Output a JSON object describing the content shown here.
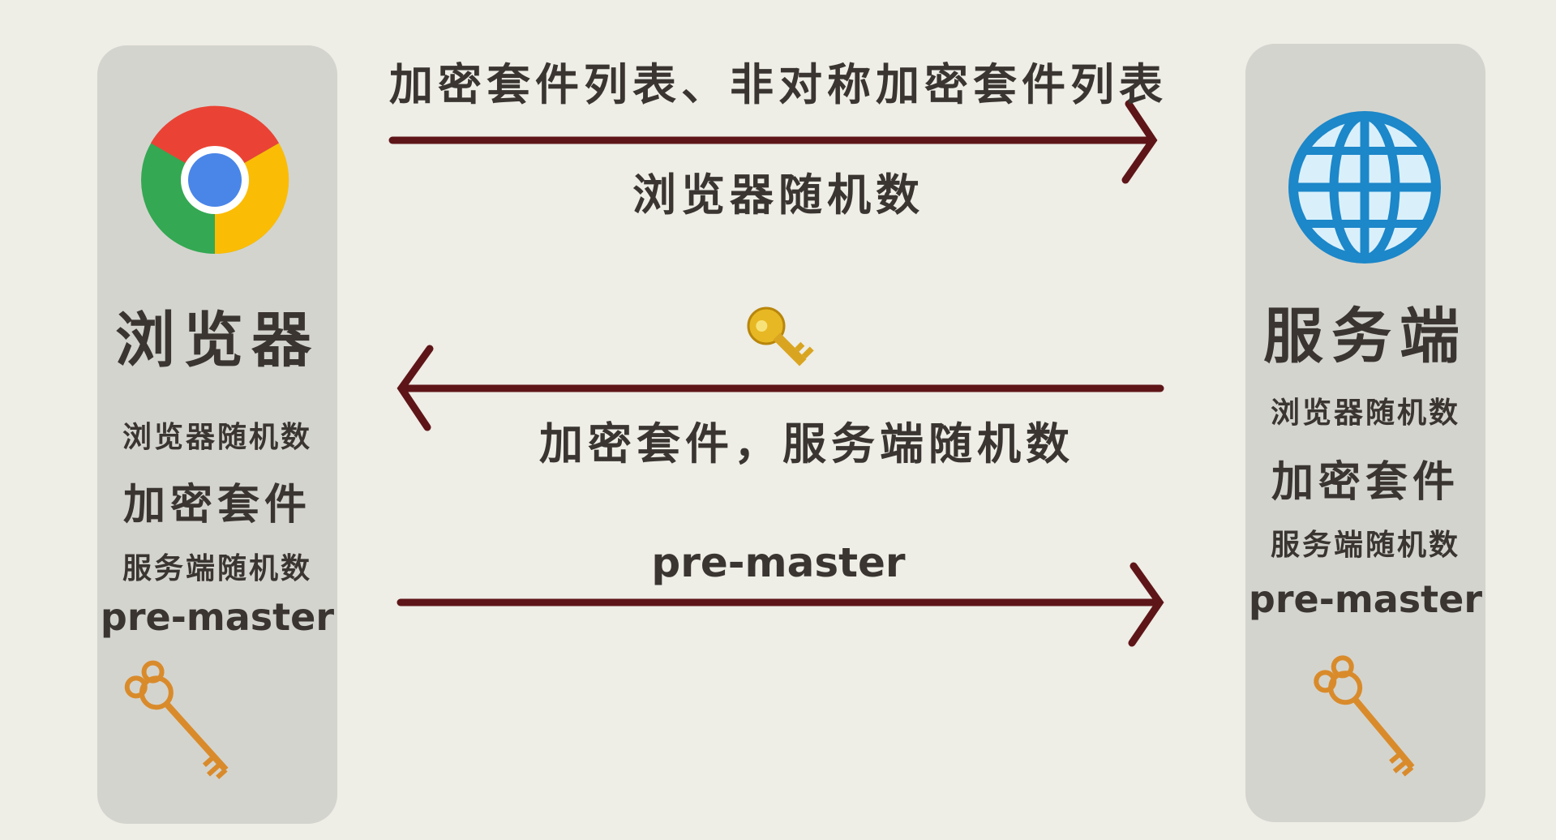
{
  "browser": {
    "title": "浏览器",
    "items": [
      "浏览器随机数",
      "加密套件",
      "服务端随机数",
      "pre-master"
    ]
  },
  "server": {
    "title": "服务端",
    "items": [
      "浏览器随机数",
      "加密套件",
      "服务端随机数",
      "pre-master"
    ]
  },
  "messages": {
    "msg1_top": "加密套件列表、非对称加密套件列表",
    "msg1_bottom": "浏览器随机数",
    "msg2": "加密套件，服务端随机数",
    "msg3": "pre-master"
  },
  "icons": {
    "browser": "chrome-icon",
    "server": "globe-icon",
    "public_key": "key-icon",
    "session_key": "ornate-key-icon"
  },
  "colors": {
    "arrow": "#5e1518",
    "panel": "#d4d4ce",
    "background": "#eeede6",
    "text": "#3a3531"
  }
}
